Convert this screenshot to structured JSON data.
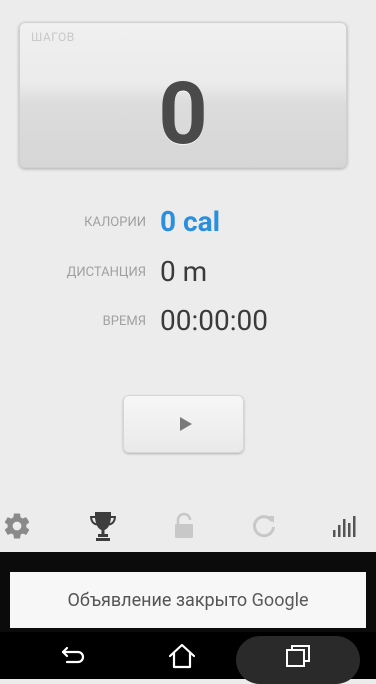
{
  "steps": {
    "label": "ШАГОВ",
    "value": "0"
  },
  "stats": {
    "calories": {
      "label": "КАЛОРИИ",
      "value": "0 cal"
    },
    "distance": {
      "label": "ДИСТАНЦИЯ",
      "value": "0 m"
    },
    "time": {
      "label": "ВРЕМЯ",
      "value": "00:00:00"
    }
  },
  "controls": {
    "play": "play-icon"
  },
  "toolbar": {
    "items": [
      "gear-icon",
      "trophy-icon",
      "lock-icon",
      "refresh-icon",
      "stats-bars-icon"
    ]
  },
  "ad": {
    "text_prefix": "Объявление закрыто",
    "brand": "Google"
  },
  "navigation": {
    "buttons": [
      "back-icon",
      "home-icon",
      "recents-icon"
    ]
  },
  "colors": {
    "accent": "#2b8fde",
    "background": "#ececec",
    "icon": "#8a8a8a"
  }
}
